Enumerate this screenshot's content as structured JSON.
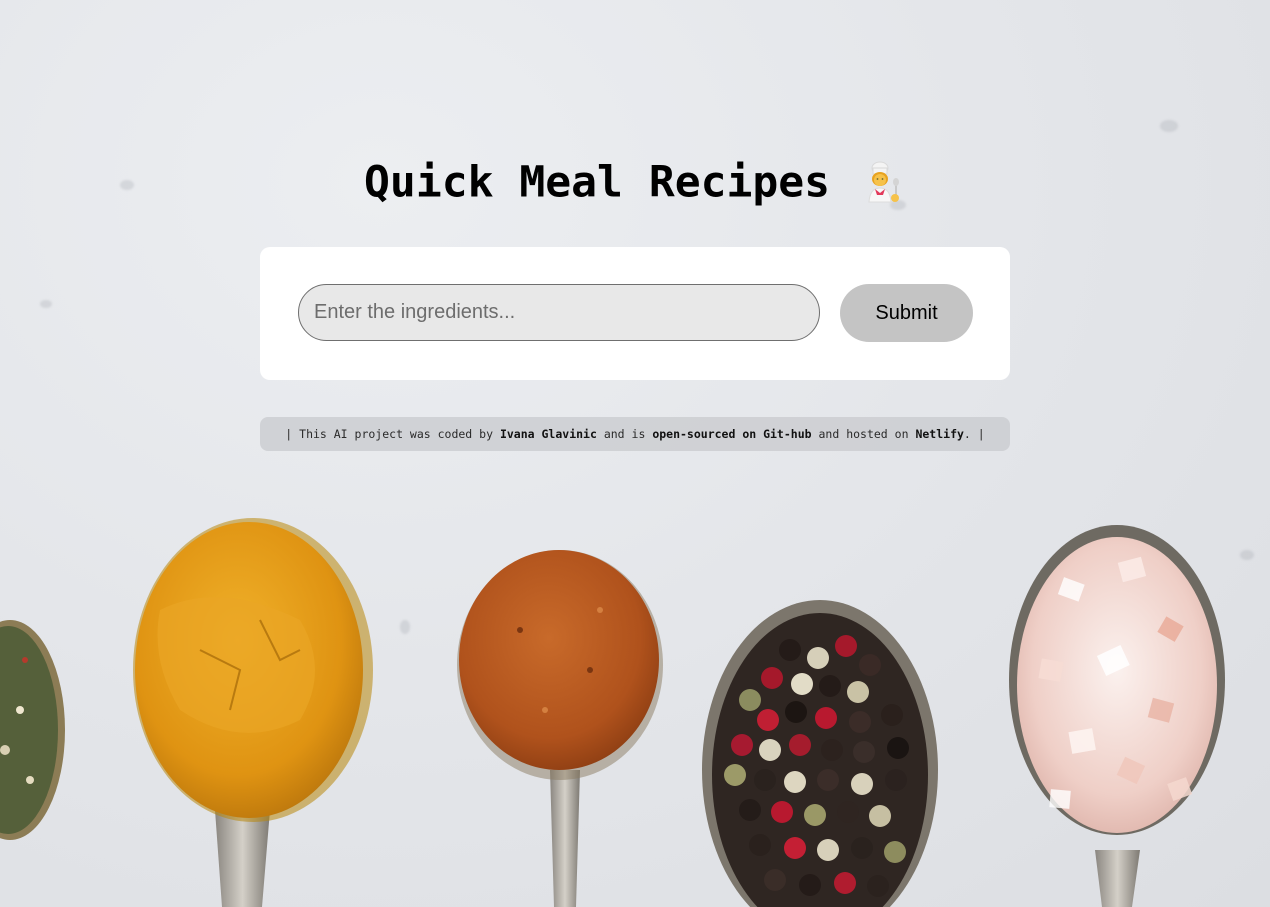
{
  "header": {
    "title": "Quick Meal Recipes",
    "icon": "chef-emoji-icon"
  },
  "form": {
    "input_placeholder": "Enter the ingredients...",
    "input_value": "",
    "submit_label": "Submit"
  },
  "credits": {
    "prefix": "| This AI project was coded by",
    "author": "Ivana Glavinic",
    "middle": "and is",
    "repo_link": "open-sourced on Git-hub",
    "hosted_text": "and hosted on",
    "host": "Netlify",
    "suffix": ". |"
  },
  "background": {
    "description_icon": "spice-spoons-image",
    "marble_color": "#e3e5e9",
    "colors": {
      "turmeric": "#e19a14",
      "paprika": "#b9581f",
      "salt": "#f1d6d0",
      "herbs": "#4f5b2f"
    }
  }
}
